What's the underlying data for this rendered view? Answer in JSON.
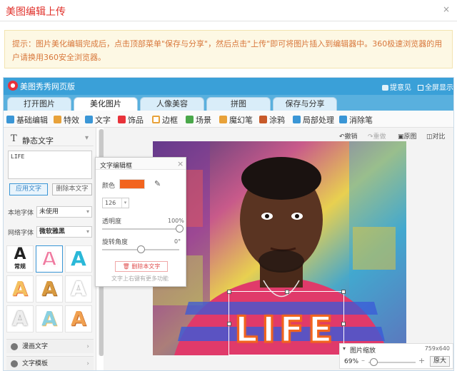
{
  "dialog": {
    "title": "美图编辑上传",
    "close": "×"
  },
  "tip": {
    "text": "提示：图片美化编辑完成后，点击顶部菜单\"保存与分享\"，然后点击\"上传\"即可将图片插入到编辑器中。360极速浏览器的用户请换用360安全浏览器。"
  },
  "app": {
    "name": "美图秀秀网页版",
    "feedback": "提意见",
    "fullscreen": "全屏显示"
  },
  "tabs": [
    {
      "label": "打开图片"
    },
    {
      "label": "美化图片"
    },
    {
      "label": "人像美容"
    },
    {
      "label": "拼图"
    },
    {
      "label": "保存与分享"
    }
  ],
  "toolbar": [
    {
      "label": "基础编辑",
      "icon": "edit-icon",
      "color": "#3a96d6"
    },
    {
      "label": "特效",
      "icon": "magic-icon",
      "color": "#e8a23a"
    },
    {
      "label": "文字",
      "icon": "text-icon",
      "color": "#3a96d6"
    },
    {
      "label": "饰品",
      "icon": "bow-icon",
      "color": "#e8323a"
    },
    {
      "label": "边框",
      "icon": "frame-icon",
      "color": "#e8a23a"
    },
    {
      "label": "场景",
      "icon": "scene-icon",
      "color": "#4aa84a"
    },
    {
      "label": "魔幻笔",
      "icon": "pen-icon",
      "color": "#e8a23a"
    },
    {
      "label": "涂鸦",
      "icon": "brush-icon",
      "color": "#c85a2a"
    },
    {
      "label": "局部处理",
      "icon": "local-icon",
      "color": "#3a96d6"
    },
    {
      "label": "消除笔",
      "icon": "eraser-icon",
      "color": "#3a96d6"
    }
  ],
  "left": {
    "header": "静态文字",
    "text_value": "LIFE",
    "apply_label": "应用文字",
    "delete_label": "删除本文字",
    "local_font_label": "本地字体",
    "local_font_value": "未使用",
    "net_font_label": "网络字体",
    "net_font_value": "微软雅黑",
    "items": [
      {
        "label": "漫画文字"
      },
      {
        "label": "文字模板"
      }
    ]
  },
  "font_styles": [
    {
      "text": "A",
      "sub": "常规",
      "color": "#222"
    },
    {
      "text": "A",
      "color": "#f07aa0"
    },
    {
      "text": "A",
      "color": "#2ab8d8"
    },
    {
      "text": "A",
      "color": "#f4c060"
    },
    {
      "text": "A",
      "color": "#d89a40"
    },
    {
      "text": "A",
      "color": "#dddddd"
    },
    {
      "text": "A",
      "color": "#cccccc"
    },
    {
      "text": "A",
      "color": "#8ad0e0"
    },
    {
      "text": "A",
      "color": "#f0a050"
    }
  ],
  "canvas_toolbar": {
    "undo": "撤销",
    "redo": "重做",
    "original": "原图",
    "compare": "对比"
  },
  "editor": {
    "title": "文字编辑框",
    "color_label": "颜色",
    "color_value": "#f2641e",
    "size_value": "126",
    "opacity_label": "透明度",
    "opacity_value": "100%",
    "opacity": 1.0,
    "rotate_label": "旋转角度",
    "rotate_value": "0°",
    "rotate": 0.5,
    "delete_label": "删除本文字",
    "hint": "文字上右键有更多功能"
  },
  "overlay_text": "LIFE",
  "zoom": {
    "label": "图片缩放",
    "size": "759x640",
    "percent": "69%",
    "level": 0.1,
    "original_label": "原大"
  }
}
